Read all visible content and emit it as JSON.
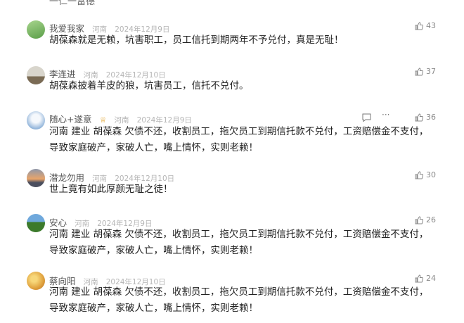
{
  "top_cut_text": "一仁一富德",
  "comments": [
    {
      "name": "我爱我家",
      "location": "河南",
      "date": "2024年12月9日",
      "text": "胡葆森就是无赖，坑害职工，员工信托到期两年不予兑付，真是无耻！",
      "likes": "43",
      "avatar_colors": [
        "#a8d58e",
        "#5a9e48"
      ]
    },
    {
      "name": "李连进",
      "location": "河南",
      "date": "2024年12月10日",
      "text": "胡葆森披着羊皮的狼，坑害员工，信托不兑付。",
      "likes": "37",
      "avatar_colors": [
        "#c8c3b4",
        "#8a7a63"
      ]
    },
    {
      "name": "随心+遂意",
      "vip_icon": "crown-icon",
      "location": "河南",
      "date": "2024年12月9日",
      "text": "河南 建业 胡葆森  欠债不还，收割员工，拖欠员工到期信托款不兑付，工资赔偿金不支付，导致家庭破产，家破人亡，嘴上情怀，实则老赖！",
      "likes": "36",
      "avatar_colors": [
        "#d4e3f2",
        "#6c93c4"
      ],
      "has_actions": true
    },
    {
      "name": "潜龙勿用",
      "location": "河南",
      "date": "2024年12月10日",
      "text": "世上竟有如此厚颜无耻之徒！",
      "likes": "30",
      "avatar_colors": [
        "#e9a56b",
        "#6a6f85"
      ]
    },
    {
      "name": "安心",
      "location": "河南",
      "date": "2024年12月9日",
      "text": "河南 建业 胡葆森  欠债不还，收割员工，拖欠员工到期信托款不兑付，工资赔偿金不支付，导致家庭破产，家破人亡，嘴上情怀，实则老赖！",
      "likes": "26",
      "avatar_colors": [
        "#7fb3e0",
        "#3e7d2f"
      ]
    },
    {
      "name": "蔡向阳",
      "location": "河南",
      "date": "2024年12月10日",
      "text": "河南 建业 胡葆森  欠债不还，收割员工，拖欠员工到期信托款不兑付，工资赔偿金不支付，导致家庭破产，家破人亡，嘴上情怀，实则老赖！",
      "likes": "24",
      "avatar_colors": [
        "#f2c05a",
        "#c7782a"
      ]
    }
  ]
}
